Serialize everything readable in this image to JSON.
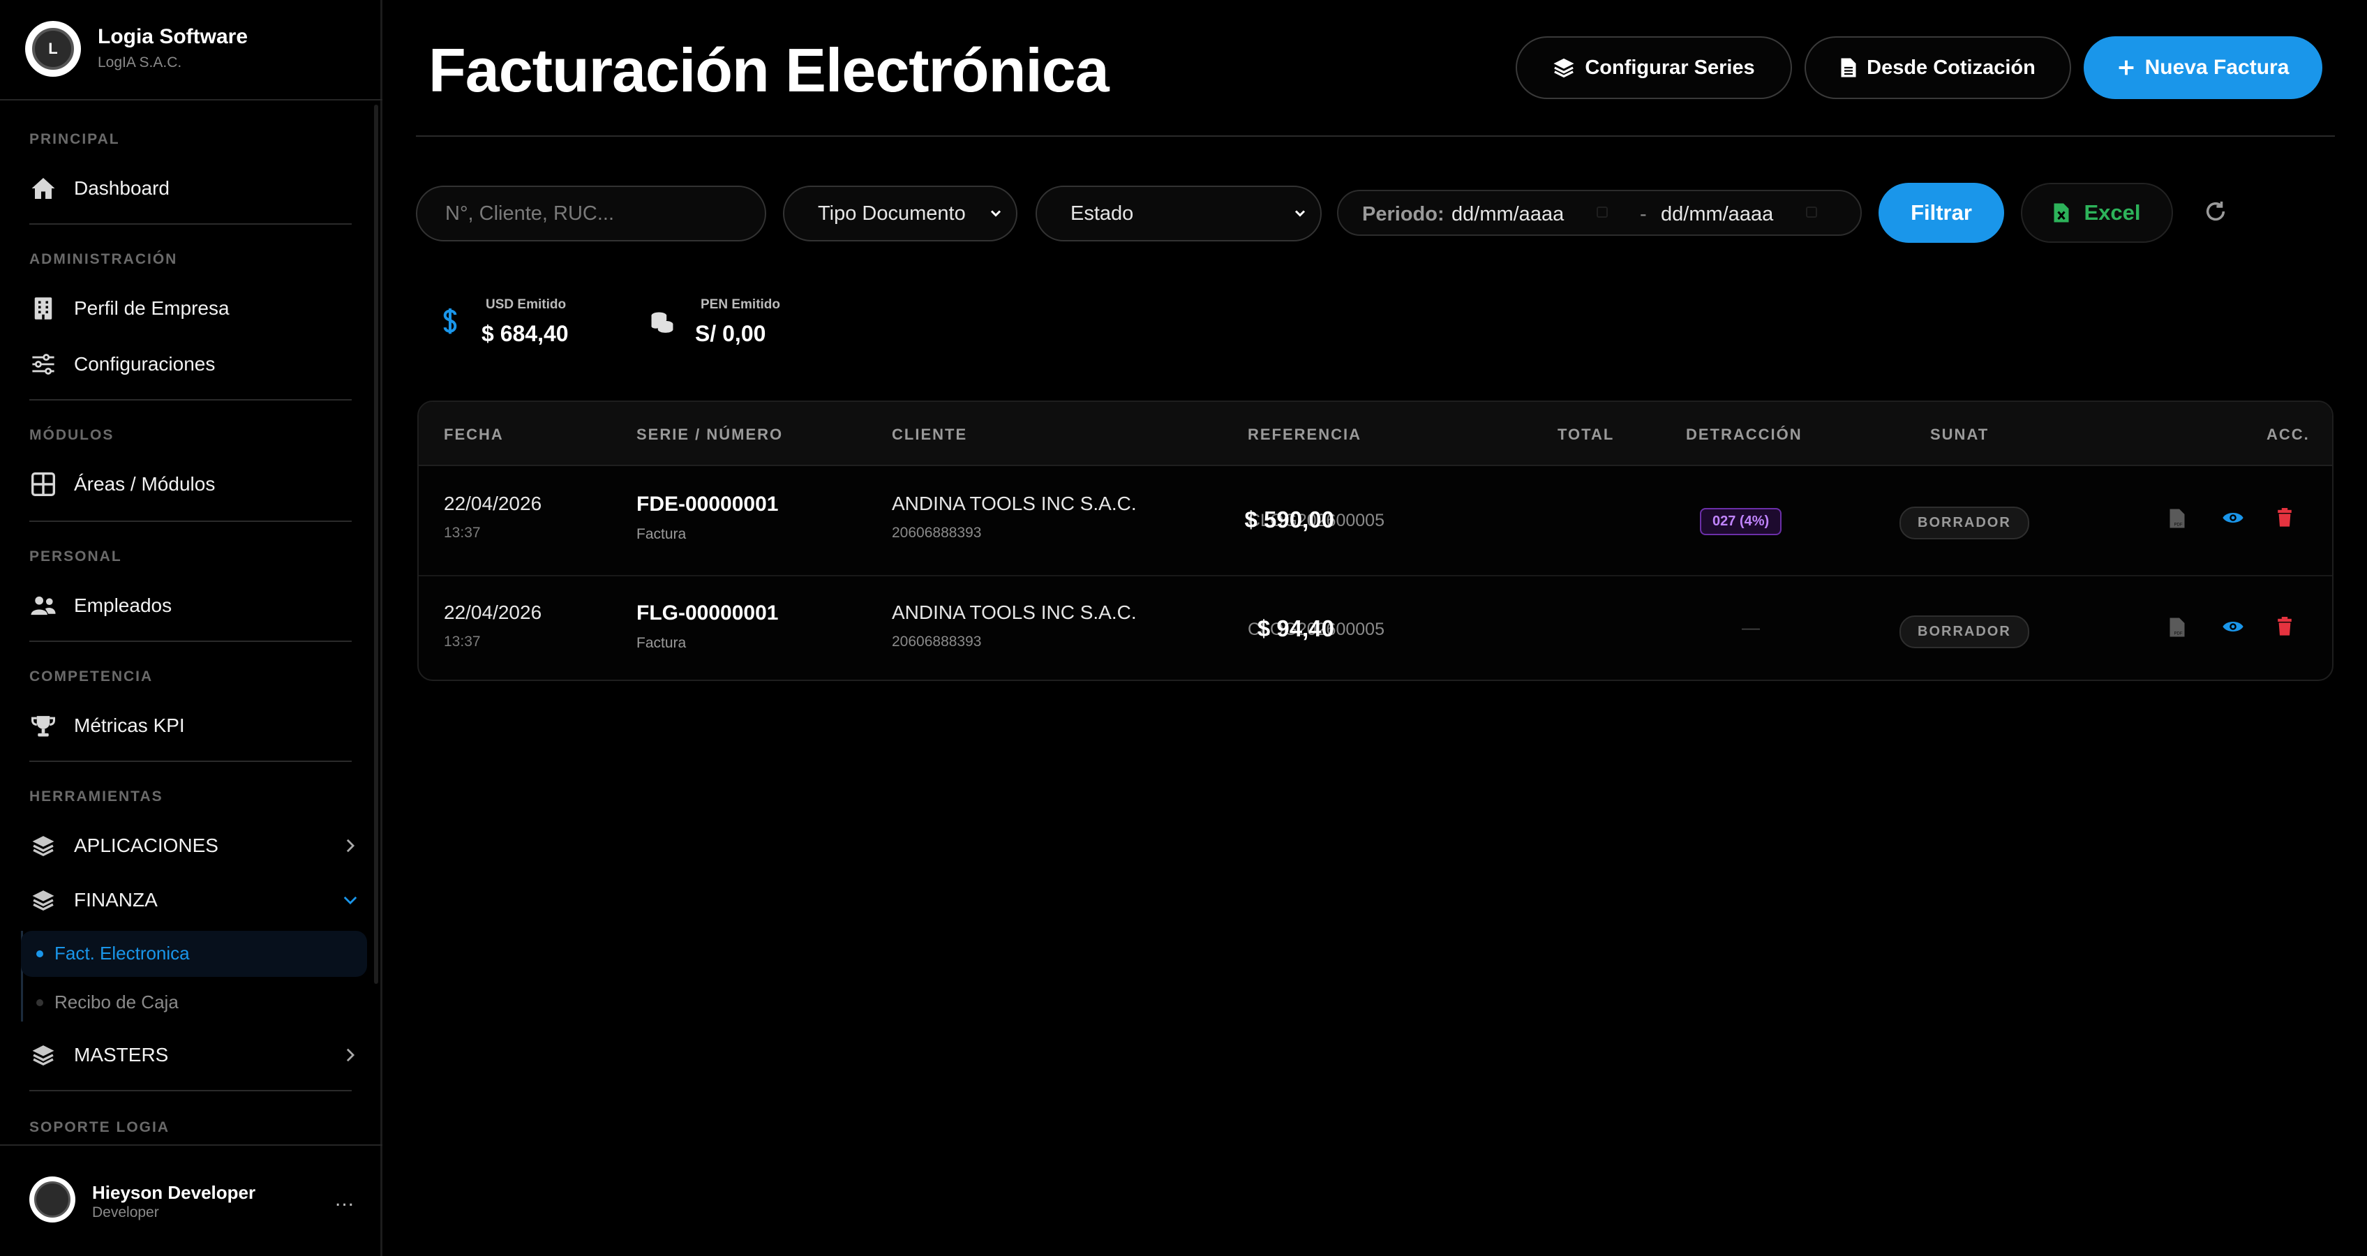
{
  "brand": {
    "name": "Logia Software",
    "company": "LogIA S.A.C."
  },
  "sidebar": {
    "sections": [
      {
        "title": "PRINCIPAL"
      },
      {
        "title": "ADMINISTRACIÓN"
      },
      {
        "title": "MÓDULOS"
      },
      {
        "title": "PERSONAL"
      },
      {
        "title": "COMPETENCIA"
      },
      {
        "title": "HERRAMIENTAS"
      },
      {
        "title": "SOPORTE LOGIA"
      }
    ],
    "items": {
      "dashboard": "Dashboard",
      "perfil": "Perfil de Empresa",
      "config": "Configuraciones",
      "areas": "Áreas / Módulos",
      "empleados": "Empleados",
      "kpi": "Métricas KPI",
      "aplicaciones": "APLICACIONES",
      "finanza": "FINANZA",
      "masters": "MASTERS"
    },
    "finanza_sub": {
      "active": "Fact. Electronica",
      "other": "Recibo de Caja"
    }
  },
  "user": {
    "name": "Hieyson Developer",
    "role": "Developer",
    "menu": "..."
  },
  "header": {
    "title": "Facturación Electrónica",
    "btn_series": "Configurar Series",
    "btn_cotizacion": "Desde Cotización",
    "btn_nueva": "Nueva Factura"
  },
  "filters": {
    "search_placeholder": "N°, Cliente, RUC...",
    "tipo": "Tipo Documento",
    "estado": "Estado",
    "periodo_label": "Periodo:",
    "date_from": "dd/mm/aaaa",
    "date_sep": "-",
    "date_to": "dd/mm/aaaa",
    "filtrar": "Filtrar",
    "excel": "Excel"
  },
  "stats": [
    {
      "label": "USD Emitido",
      "value": "$ 684,40"
    },
    {
      "label": "PEN Emitido",
      "value": "S/ 0,00"
    }
  ],
  "table": {
    "headers": [
      "FECHA",
      "SERIE / NÚMERO",
      "CLIENTE",
      "REFERENCIA",
      "TOTAL",
      "DETRACCIÓN",
      "SUNAT",
      "ACC."
    ],
    "rows": [
      {
        "fecha": "22/04/2026",
        "hora": "13:37",
        "numero": "FDE-00000001",
        "tipo": "Factura",
        "cliente": "ANDINA TOOLS INC S.A.C.",
        "ruc": "20606888393",
        "referencia": "CLOG202600005",
        "total": "$ 590,00",
        "detraccion": "027 (4%)",
        "sunat": "BORRADOR"
      },
      {
        "fecha": "22/04/2026",
        "hora": "13:37",
        "numero": "FLG-00000001",
        "tipo": "Factura",
        "cliente": "ANDINA TOOLS INC S.A.C.",
        "ruc": "20606888393",
        "referencia": "CLOG202600005",
        "total": "$ 94,40",
        "detraccion": "—",
        "sunat": "BORRADOR"
      }
    ]
  },
  "colors": {
    "accent": "#1a96ea",
    "excel": "#2db35a",
    "delete": "#e5333f",
    "detraccion": "#c084fc"
  },
  "icons": [
    "home-icon",
    "building-icon",
    "sliders-icon",
    "grid-icon",
    "users-icon",
    "trophy-icon",
    "layers-icon",
    "chevron-right-icon",
    "chevron-down-icon",
    "plus-icon",
    "document-icon",
    "dollar-icon",
    "coins-icon",
    "file-excel-icon",
    "refresh-icon",
    "pdf-icon",
    "eye-icon",
    "trash-icon"
  ]
}
